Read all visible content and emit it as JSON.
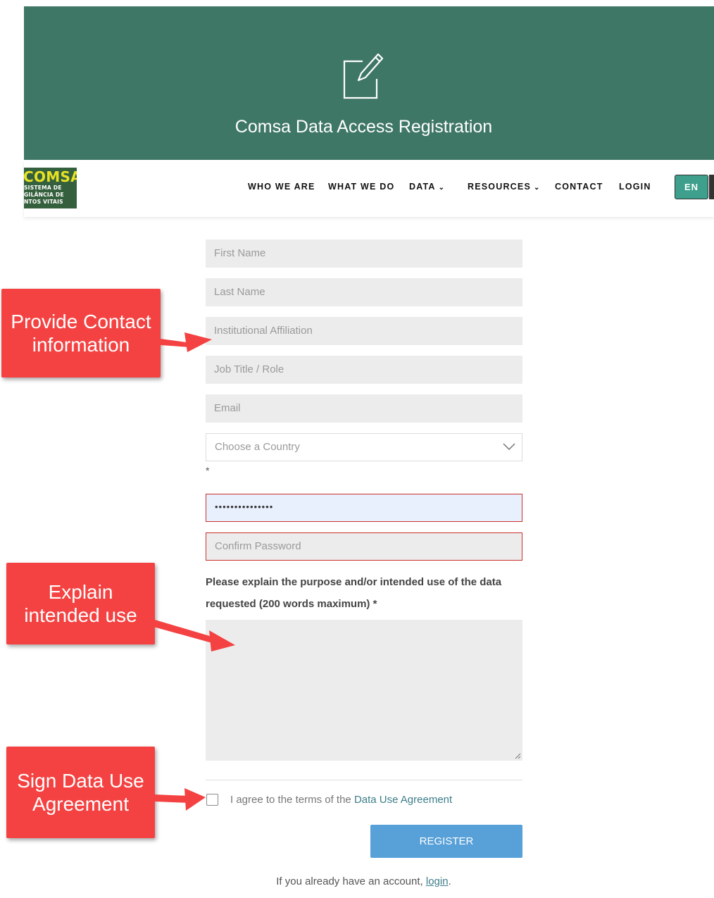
{
  "hero": {
    "title": "Comsa Data Access Registration",
    "icon": "edit-icon",
    "background": "#3f7767"
  },
  "logo": {
    "brand": "COMSA",
    "lines": [
      "SISTEMA DE",
      "GILÂNCIA DE",
      "NTOS VITAIS"
    ]
  },
  "nav": {
    "items": [
      {
        "label": "WHO WE ARE"
      },
      {
        "label": "WHAT WE DO"
      },
      {
        "label": "DATA",
        "dropdown": true
      },
      {
        "label": "RESOURCES",
        "dropdown": true
      },
      {
        "label": "CONTACT"
      },
      {
        "label": "LOGIN"
      }
    ],
    "lang": "EN"
  },
  "form": {
    "first_name_placeholder": "First Name",
    "last_name_placeholder": "Last Name",
    "affiliation_placeholder": "Institutional Affiliation",
    "job_placeholder": "Job Title / Role",
    "email_placeholder": "Email",
    "country_selected": "Choose a Country",
    "country_required": "*",
    "password_value": "•••••••••••••••",
    "confirm_placeholder": "Confirm Password",
    "purpose_label": "Please explain the purpose and/or intended use of the data requested (200 words maximum) *",
    "agree_text": "I agree to the terms of the ",
    "agree_link": "Data Use Agreement",
    "register_label": "REGISTER",
    "login_prompt": "If you already have an account, ",
    "login_link": "login",
    "login_suffix": "."
  },
  "callouts": {
    "contact": "Provide Contact information",
    "intended": "Explain intended use",
    "agreement": "Sign Data Use Agreement"
  },
  "colors": {
    "accent": "#3f7767",
    "button": "#57a0d8",
    "callout": "#f44242",
    "error_border": "#c9302c",
    "lang_button": "#3d9f8c"
  }
}
